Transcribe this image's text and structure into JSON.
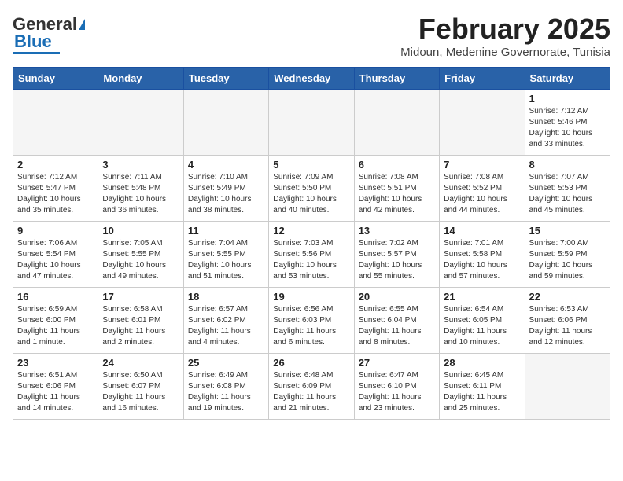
{
  "logo": {
    "general": "General",
    "blue": "Blue"
  },
  "header": {
    "title": "February 2025",
    "subtitle": "Midoun, Medenine Governorate, Tunisia"
  },
  "days_of_week": [
    "Sunday",
    "Monday",
    "Tuesday",
    "Wednesday",
    "Thursday",
    "Friday",
    "Saturday"
  ],
  "weeks": [
    [
      {
        "day": "",
        "info": ""
      },
      {
        "day": "",
        "info": ""
      },
      {
        "day": "",
        "info": ""
      },
      {
        "day": "",
        "info": ""
      },
      {
        "day": "",
        "info": ""
      },
      {
        "day": "",
        "info": ""
      },
      {
        "day": "1",
        "info": "Sunrise: 7:12 AM\nSunset: 5:46 PM\nDaylight: 10 hours\nand 33 minutes."
      }
    ],
    [
      {
        "day": "2",
        "info": "Sunrise: 7:12 AM\nSunset: 5:47 PM\nDaylight: 10 hours\nand 35 minutes."
      },
      {
        "day": "3",
        "info": "Sunrise: 7:11 AM\nSunset: 5:48 PM\nDaylight: 10 hours\nand 36 minutes."
      },
      {
        "day": "4",
        "info": "Sunrise: 7:10 AM\nSunset: 5:49 PM\nDaylight: 10 hours\nand 38 minutes."
      },
      {
        "day": "5",
        "info": "Sunrise: 7:09 AM\nSunset: 5:50 PM\nDaylight: 10 hours\nand 40 minutes."
      },
      {
        "day": "6",
        "info": "Sunrise: 7:08 AM\nSunset: 5:51 PM\nDaylight: 10 hours\nand 42 minutes."
      },
      {
        "day": "7",
        "info": "Sunrise: 7:08 AM\nSunset: 5:52 PM\nDaylight: 10 hours\nand 44 minutes."
      },
      {
        "day": "8",
        "info": "Sunrise: 7:07 AM\nSunset: 5:53 PM\nDaylight: 10 hours\nand 45 minutes."
      }
    ],
    [
      {
        "day": "9",
        "info": "Sunrise: 7:06 AM\nSunset: 5:54 PM\nDaylight: 10 hours\nand 47 minutes."
      },
      {
        "day": "10",
        "info": "Sunrise: 7:05 AM\nSunset: 5:55 PM\nDaylight: 10 hours\nand 49 minutes."
      },
      {
        "day": "11",
        "info": "Sunrise: 7:04 AM\nSunset: 5:55 PM\nDaylight: 10 hours\nand 51 minutes."
      },
      {
        "day": "12",
        "info": "Sunrise: 7:03 AM\nSunset: 5:56 PM\nDaylight: 10 hours\nand 53 minutes."
      },
      {
        "day": "13",
        "info": "Sunrise: 7:02 AM\nSunset: 5:57 PM\nDaylight: 10 hours\nand 55 minutes."
      },
      {
        "day": "14",
        "info": "Sunrise: 7:01 AM\nSunset: 5:58 PM\nDaylight: 10 hours\nand 57 minutes."
      },
      {
        "day": "15",
        "info": "Sunrise: 7:00 AM\nSunset: 5:59 PM\nDaylight: 10 hours\nand 59 minutes."
      }
    ],
    [
      {
        "day": "16",
        "info": "Sunrise: 6:59 AM\nSunset: 6:00 PM\nDaylight: 11 hours\nand 1 minute."
      },
      {
        "day": "17",
        "info": "Sunrise: 6:58 AM\nSunset: 6:01 PM\nDaylight: 11 hours\nand 2 minutes."
      },
      {
        "day": "18",
        "info": "Sunrise: 6:57 AM\nSunset: 6:02 PM\nDaylight: 11 hours\nand 4 minutes."
      },
      {
        "day": "19",
        "info": "Sunrise: 6:56 AM\nSunset: 6:03 PM\nDaylight: 11 hours\nand 6 minutes."
      },
      {
        "day": "20",
        "info": "Sunrise: 6:55 AM\nSunset: 6:04 PM\nDaylight: 11 hours\nand 8 minutes."
      },
      {
        "day": "21",
        "info": "Sunrise: 6:54 AM\nSunset: 6:05 PM\nDaylight: 11 hours\nand 10 minutes."
      },
      {
        "day": "22",
        "info": "Sunrise: 6:53 AM\nSunset: 6:06 PM\nDaylight: 11 hours\nand 12 minutes."
      }
    ],
    [
      {
        "day": "23",
        "info": "Sunrise: 6:51 AM\nSunset: 6:06 PM\nDaylight: 11 hours\nand 14 minutes."
      },
      {
        "day": "24",
        "info": "Sunrise: 6:50 AM\nSunset: 6:07 PM\nDaylight: 11 hours\nand 16 minutes."
      },
      {
        "day": "25",
        "info": "Sunrise: 6:49 AM\nSunset: 6:08 PM\nDaylight: 11 hours\nand 19 minutes."
      },
      {
        "day": "26",
        "info": "Sunrise: 6:48 AM\nSunset: 6:09 PM\nDaylight: 11 hours\nand 21 minutes."
      },
      {
        "day": "27",
        "info": "Sunrise: 6:47 AM\nSunset: 6:10 PM\nDaylight: 11 hours\nand 23 minutes."
      },
      {
        "day": "28",
        "info": "Sunrise: 6:45 AM\nSunset: 6:11 PM\nDaylight: 11 hours\nand 25 minutes."
      },
      {
        "day": "",
        "info": ""
      }
    ]
  ]
}
